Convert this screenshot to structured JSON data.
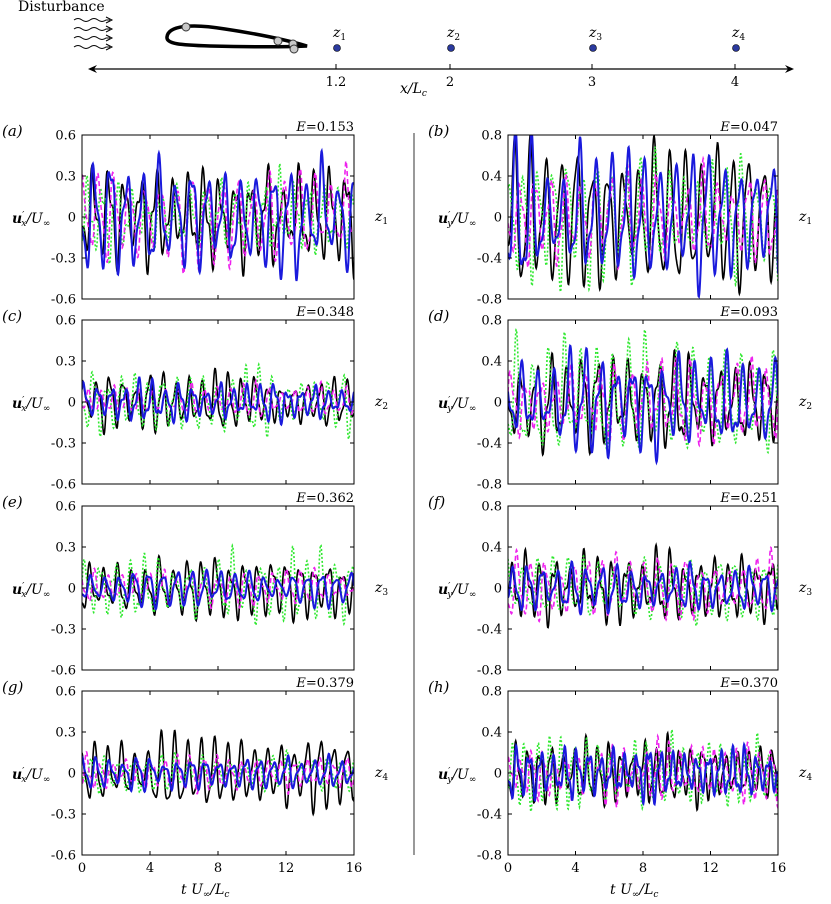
{
  "top_diagram": {
    "disturbance_label": "Disturbance",
    "axis_label": "x/L",
    "axis_label_sub": "c",
    "ticks": [
      "1.2",
      "2",
      "3",
      "4"
    ],
    "probes": [
      {
        "label": "z",
        "sub": "1"
      },
      {
        "label": "z",
        "sub": "2"
      },
      {
        "label": "z",
        "sub": "3"
      },
      {
        "label": "z",
        "sub": "4"
      }
    ],
    "probe_color": "#2b3a9e"
  },
  "colors": {
    "black": "#000000",
    "green": "#2ee82e",
    "magenta": "#ee22ee",
    "blue": "#1a1adc"
  },
  "x_axis": {
    "label": "t U",
    "label_sub_inf": "∞",
    "label_over": "/L",
    "label_sub_c": "c",
    "ticks": [
      "0",
      "4",
      "8",
      "12",
      "16"
    ],
    "range": [
      0,
      16
    ]
  },
  "chart_data": [
    {
      "type": "line",
      "panel": "(a)",
      "component": "x",
      "probe": "z",
      "probe_sub": "1",
      "energy": "E=0.153",
      "ylim": [
        -0.6,
        0.6
      ],
      "yticks": [
        "0.6",
        "0.3",
        "0",
        "-0.3",
        "-0.6"
      ],
      "freq": 1.1,
      "amps": {
        "black": 0.35,
        "green": 0.28,
        "magenta": 0.32,
        "blue": 0.42
      },
      "series": [
        "black",
        "green",
        "magenta",
        "blue"
      ]
    },
    {
      "type": "line",
      "panel": "(b)",
      "component": "y",
      "probe": "z",
      "probe_sub": "1",
      "energy": "E=0.047",
      "ylim": [
        -0.8,
        0.8
      ],
      "yticks": [
        "0.8",
        "0.4",
        "0",
        "-0.4",
        "-0.8"
      ],
      "freq": 1.1,
      "amps": {
        "black": 0.68,
        "green": 0.6,
        "magenta": 0.45,
        "blue": 0.65
      },
      "series": [
        "black",
        "green",
        "magenta",
        "blue"
      ]
    },
    {
      "type": "line",
      "panel": "(c)",
      "component": "x",
      "probe": "z",
      "probe_sub": "2",
      "energy": "E=0.348",
      "ylim": [
        -0.6,
        0.6
      ],
      "yticks": [
        "0.6",
        "0.3",
        "0",
        "-0.3",
        "-0.6"
      ],
      "freq": 1.3,
      "amps": {
        "black": 0.2,
        "green": 0.22,
        "magenta": 0.12,
        "blue": 0.14
      },
      "series": [
        "black",
        "green",
        "magenta",
        "blue"
      ]
    },
    {
      "type": "line",
      "panel": "(d)",
      "component": "y",
      "probe": "z",
      "probe_sub": "2",
      "energy": "E=0.093",
      "ylim": [
        -0.8,
        0.8
      ],
      "yticks": [
        "0.8",
        "0.4",
        "0",
        "-0.4",
        "-0.8"
      ],
      "freq": 1.1,
      "amps": {
        "black": 0.46,
        "green": 0.55,
        "magenta": 0.42,
        "blue": 0.48
      },
      "series": [
        "black",
        "green",
        "magenta",
        "blue"
      ]
    },
    {
      "type": "line",
      "panel": "(e)",
      "component": "x",
      "probe": "z",
      "probe_sub": "3",
      "energy": "E=0.362",
      "ylim": [
        -0.6,
        0.6
      ],
      "yticks": [
        "0.6",
        "0.3",
        "0",
        "-0.3",
        "-0.6"
      ],
      "freq": 1.2,
      "amps": {
        "black": 0.22,
        "green": 0.26,
        "magenta": 0.12,
        "blue": 0.12
      },
      "series": [
        "black",
        "green",
        "magenta",
        "blue"
      ]
    },
    {
      "type": "line",
      "panel": "(f)",
      "component": "y",
      "probe": "z",
      "probe_sub": "3",
      "energy": "E=0.251",
      "ylim": [
        -0.8,
        0.8
      ],
      "yticks": [
        "0.8",
        "0.4",
        "0",
        "-0.4",
        "-0.8"
      ],
      "freq": 1.15,
      "amps": {
        "black": 0.33,
        "green": 0.3,
        "magenta": 0.32,
        "blue": 0.22
      },
      "series": [
        "black",
        "green",
        "magenta",
        "blue"
      ]
    },
    {
      "type": "line",
      "panel": "(g)",
      "component": "x",
      "probe": "z",
      "probe_sub": "4",
      "energy": "E=0.379",
      "ylim": [
        -0.6,
        0.6
      ],
      "yticks": [
        "0.6",
        "0.3",
        "0",
        "-0.3",
        "-0.6"
      ],
      "freq": 1.25,
      "amps": {
        "black": 0.24,
        "green": 0.14,
        "magenta": 0.12,
        "blue": 0.12
      },
      "series": [
        "black",
        "green",
        "magenta",
        "blue"
      ]
    },
    {
      "type": "line",
      "panel": "(h)",
      "component": "y",
      "probe": "z",
      "probe_sub": "4",
      "energy": "E=0.370",
      "ylim": [
        -0.8,
        0.8
      ],
      "yticks": [
        "0.8",
        "0.4",
        "0",
        "-0.4",
        "-0.8"
      ],
      "freq": 1.4,
      "amps": {
        "black": 0.3,
        "green": 0.36,
        "magenta": 0.28,
        "blue": 0.25
      },
      "series": [
        "black",
        "green",
        "magenta",
        "blue"
      ]
    }
  ]
}
